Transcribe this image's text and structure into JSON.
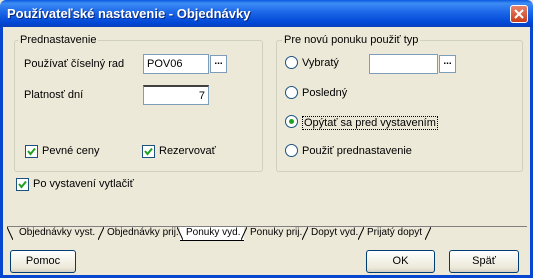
{
  "window": {
    "title": "Používateľské nastavenie - Objednávky"
  },
  "prednastavenie": {
    "title": "Prednastavenie",
    "ciselny_rad_label": "Používať číselný rad",
    "ciselny_rad_value": "POV06",
    "platnost_label": "Platnosť dní",
    "platnost_value": "7",
    "pevne_ceny_label": "Pevné ceny",
    "pevne_ceny_checked": true,
    "rezervovat_label": "Rezervovať",
    "rezervovat_checked": true
  },
  "ponuka_typ": {
    "title": "Pre novú ponuku použiť typ",
    "options": [
      {
        "label": "Vybratý",
        "selected": false
      },
      {
        "label": "Posledný",
        "selected": false
      },
      {
        "label": "Opýtať sa pred vystavením",
        "selected": true
      },
      {
        "label": "Použiť prednastavenie",
        "selected": false
      }
    ],
    "vybraty_value": ""
  },
  "po_vystaveni": {
    "label": "Po vystavení vytlačiť",
    "checked": true
  },
  "tabs": [
    {
      "label": "Objednávky vyst.",
      "active": false
    },
    {
      "label": "Objednávky prij.",
      "active": false
    },
    {
      "label": "Ponuky vyd.",
      "active": true
    },
    {
      "label": "Ponuky prij.",
      "active": false
    },
    {
      "label": "Dopyt vyd.",
      "active": false
    },
    {
      "label": "Prijatý dopyt",
      "active": false
    }
  ],
  "buttons": {
    "help": "Pomoc",
    "ok": "OK",
    "back": "Späť"
  },
  "colors": {
    "titlebar": "#0a58e0",
    "dialog_bg": "#ece9d8",
    "radio_dot": "#21a121"
  }
}
